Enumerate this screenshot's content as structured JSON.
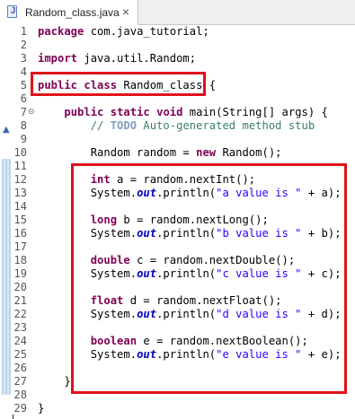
{
  "tab": {
    "title": "Random_class.java",
    "icon": "java-file-icon",
    "close_glyph": "×"
  },
  "colors": {
    "keyword": "#7f0055",
    "comment": "#3f7f5f",
    "string": "#2a00ff",
    "static_field": "#0000c0",
    "highlight_box": "#e0121b"
  },
  "code": {
    "lines": [
      {
        "n": "1",
        "t": [
          {
            "s": "package",
            "c": "kw"
          },
          {
            "s": " com.java_tutorial;"
          }
        ]
      },
      {
        "n": "2",
        "t": []
      },
      {
        "n": "3",
        "t": [
          {
            "s": "import",
            "c": "kw"
          },
          {
            "s": " java.util.Random;"
          }
        ]
      },
      {
        "n": "4",
        "t": []
      },
      {
        "n": "5",
        "t": [
          {
            "s": "public",
            "c": "kw"
          },
          {
            "s": " "
          },
          {
            "s": "class",
            "c": "kw"
          },
          {
            "s": " Random_class {"
          }
        ]
      },
      {
        "n": "6",
        "t": []
      },
      {
        "n": "7",
        "fold": "⊝",
        "t": [
          {
            "s": "    "
          },
          {
            "s": "public",
            "c": "kw"
          },
          {
            "s": " "
          },
          {
            "s": "static",
            "c": "kw"
          },
          {
            "s": " "
          },
          {
            "s": "void",
            "c": "kw"
          },
          {
            "s": " main(String[] args) {"
          }
        ]
      },
      {
        "n": "8",
        "t": [
          {
            "s": "        "
          },
          {
            "s": "// ",
            "c": "cm"
          },
          {
            "s": "TODO",
            "c": "todo"
          },
          {
            "s": " Auto-generated method stub",
            "c": "cm"
          }
        ]
      },
      {
        "n": "9",
        "t": []
      },
      {
        "n": "10",
        "t": [
          {
            "s": "        Random random = "
          },
          {
            "s": "new",
            "c": "kw"
          },
          {
            "s": " Random();"
          }
        ]
      },
      {
        "n": "11",
        "t": []
      },
      {
        "n": "12",
        "t": [
          {
            "s": "        "
          },
          {
            "s": "int",
            "c": "kw"
          },
          {
            "s": " a = random.nextInt();"
          }
        ]
      },
      {
        "n": "13",
        "t": [
          {
            "s": "        System."
          },
          {
            "s": "out",
            "c": "st"
          },
          {
            "s": ".println("
          },
          {
            "s": "\"a value is \"",
            "c": "str"
          },
          {
            "s": " + a);"
          }
        ]
      },
      {
        "n": "14",
        "t": []
      },
      {
        "n": "15",
        "t": [
          {
            "s": "        "
          },
          {
            "s": "long",
            "c": "kw"
          },
          {
            "s": " b = random.nextLong();"
          }
        ]
      },
      {
        "n": "16",
        "t": [
          {
            "s": "        System."
          },
          {
            "s": "out",
            "c": "st"
          },
          {
            "s": ".println("
          },
          {
            "s": "\"b value is \"",
            "c": "str"
          },
          {
            "s": " + b);"
          }
        ]
      },
      {
        "n": "17",
        "t": []
      },
      {
        "n": "18",
        "t": [
          {
            "s": "        "
          },
          {
            "s": "double",
            "c": "kw"
          },
          {
            "s": " c = random.nextDouble();"
          }
        ]
      },
      {
        "n": "19",
        "t": [
          {
            "s": "        System."
          },
          {
            "s": "out",
            "c": "st"
          },
          {
            "s": ".println("
          },
          {
            "s": "\"c value is \"",
            "c": "str"
          },
          {
            "s": " + c);"
          }
        ]
      },
      {
        "n": "20",
        "t": []
      },
      {
        "n": "21",
        "t": [
          {
            "s": "        "
          },
          {
            "s": "float",
            "c": "kw"
          },
          {
            "s": " d = random.nextFloat();"
          }
        ]
      },
      {
        "n": "22",
        "t": [
          {
            "s": "        System."
          },
          {
            "s": "out",
            "c": "st"
          },
          {
            "s": ".println("
          },
          {
            "s": "\"d value is \"",
            "c": "str"
          },
          {
            "s": " + d);"
          }
        ]
      },
      {
        "n": "23",
        "t": []
      },
      {
        "n": "24",
        "t": [
          {
            "s": "        "
          },
          {
            "s": "boolean",
            "c": "kw"
          },
          {
            "s": " e = random.nextBoolean();"
          }
        ]
      },
      {
        "n": "25",
        "t": [
          {
            "s": "        System."
          },
          {
            "s": "out",
            "c": "st"
          },
          {
            "s": ".println("
          },
          {
            "s": "\"e value is \"",
            "c": "str"
          },
          {
            "s": " + e);"
          }
        ]
      },
      {
        "n": "26",
        "t": []
      },
      {
        "n": "27",
        "t": [
          {
            "s": "    }"
          }
        ]
      },
      {
        "n": "28",
        "t": []
      },
      {
        "n": "29",
        "t": [
          {
            "s": "}"
          }
        ]
      }
    ]
  }
}
